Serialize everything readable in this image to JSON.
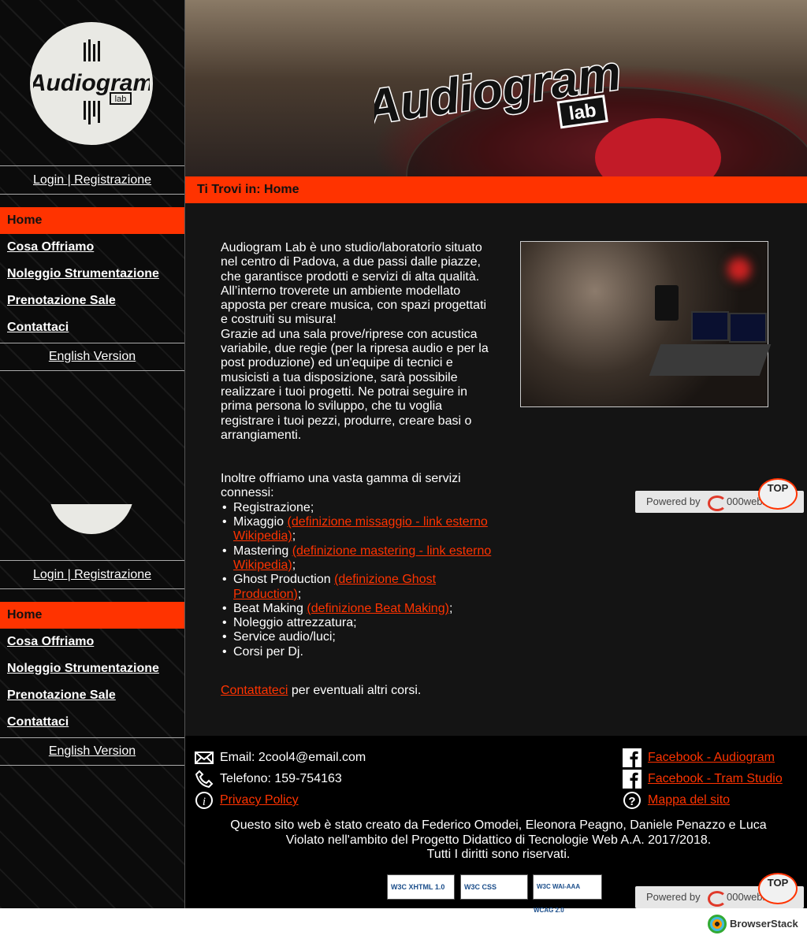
{
  "site": {
    "name": "Audiogram",
    "sub": "lab"
  },
  "sidebar": {
    "login": "Login | Registrazione",
    "menu": [
      "Home",
      "Cosa Offriamo",
      "Noleggio Strumentazione",
      "Prenotazione Sale",
      "Contattaci"
    ],
    "english": "English Version"
  },
  "breadcrumb": "Ti Trovi in: Home",
  "main": {
    "intro": "Audiogram Lab è uno studio/laboratorio situato nel centro di Padova, a due passi dalle piazze, che garantisce prodotti e servizi di alta qualità. All’interno troverete un ambiente modellato apposta per creare musica, con spazi progettati e costruiti su misura!",
    "intro2": "Grazie ad una sala prove/riprese con acustica variabile, due regie (per la ripresa audio e per la post produzione) ed un'equipe di tecnici e musicisti a tua disposizione, sarà possibile realizzare i tuoi progetti. Ne potrai seguire in prima persona lo sviluppo, che tu voglia registrare i tuoi pezzi, produrre, creare basi o arrangiamenti.",
    "services_intro": "Inoltre offriamo una vasta gamma di servizi connessi:",
    "services": [
      {
        "text": "Registrazione;",
        "link": "",
        "after": ""
      },
      {
        "text": "Mixaggio ",
        "link": "(definizione missaggio - link esterno Wikipedia)",
        "after": ";"
      },
      {
        "text": "Mastering ",
        "link": "(definizione mastering - link esterno Wikipedia)",
        "after": ";"
      },
      {
        "text": "Ghost Production ",
        "link": "(definizione Ghost Production)",
        "after": ";"
      },
      {
        "text": "Beat Making ",
        "link": "(definizione Beat Making)",
        "after": ";"
      },
      {
        "text": "Noleggio attrezzatura;",
        "link": "",
        "after": ""
      },
      {
        "text": "Service audio/luci;",
        "link": "",
        "after": ""
      },
      {
        "text": "Corsi per Dj.",
        "link": "",
        "after": ""
      }
    ],
    "contact_link": "Contattateci",
    "contact_rest": " per eventuali altri corsi."
  },
  "footer": {
    "email": "Email: 2cool4@email.com",
    "phone": "Telefono: 159-754163",
    "privacy": "Privacy Policy",
    "fb_audiogram": "Facebook - Audiogram",
    "fb_tram": "Facebook - Tram Studio",
    "sitemap": "Mappa del sito",
    "credits1": "Questo sito web è stato creato da Federico Omodei, Eleonora Peagno, Daniele Penazzo e Luca Violato nell'ambito del Progetto Didattico di Tecnologie Web A.A. 2017/2018.",
    "credits2": "Tutti I diritti sono riservati.",
    "badges": [
      "W3C XHTML 1.0",
      "W3C CSS",
      "W3C WAI-AAA WCAG 2.0"
    ]
  },
  "overlay": {
    "powered": "Powered by",
    "host": "000webhost",
    "top": "TOP"
  },
  "browserstack": "BrowserStack",
  "colors": {
    "accent": "#ff3300",
    "bg": "#141414"
  }
}
